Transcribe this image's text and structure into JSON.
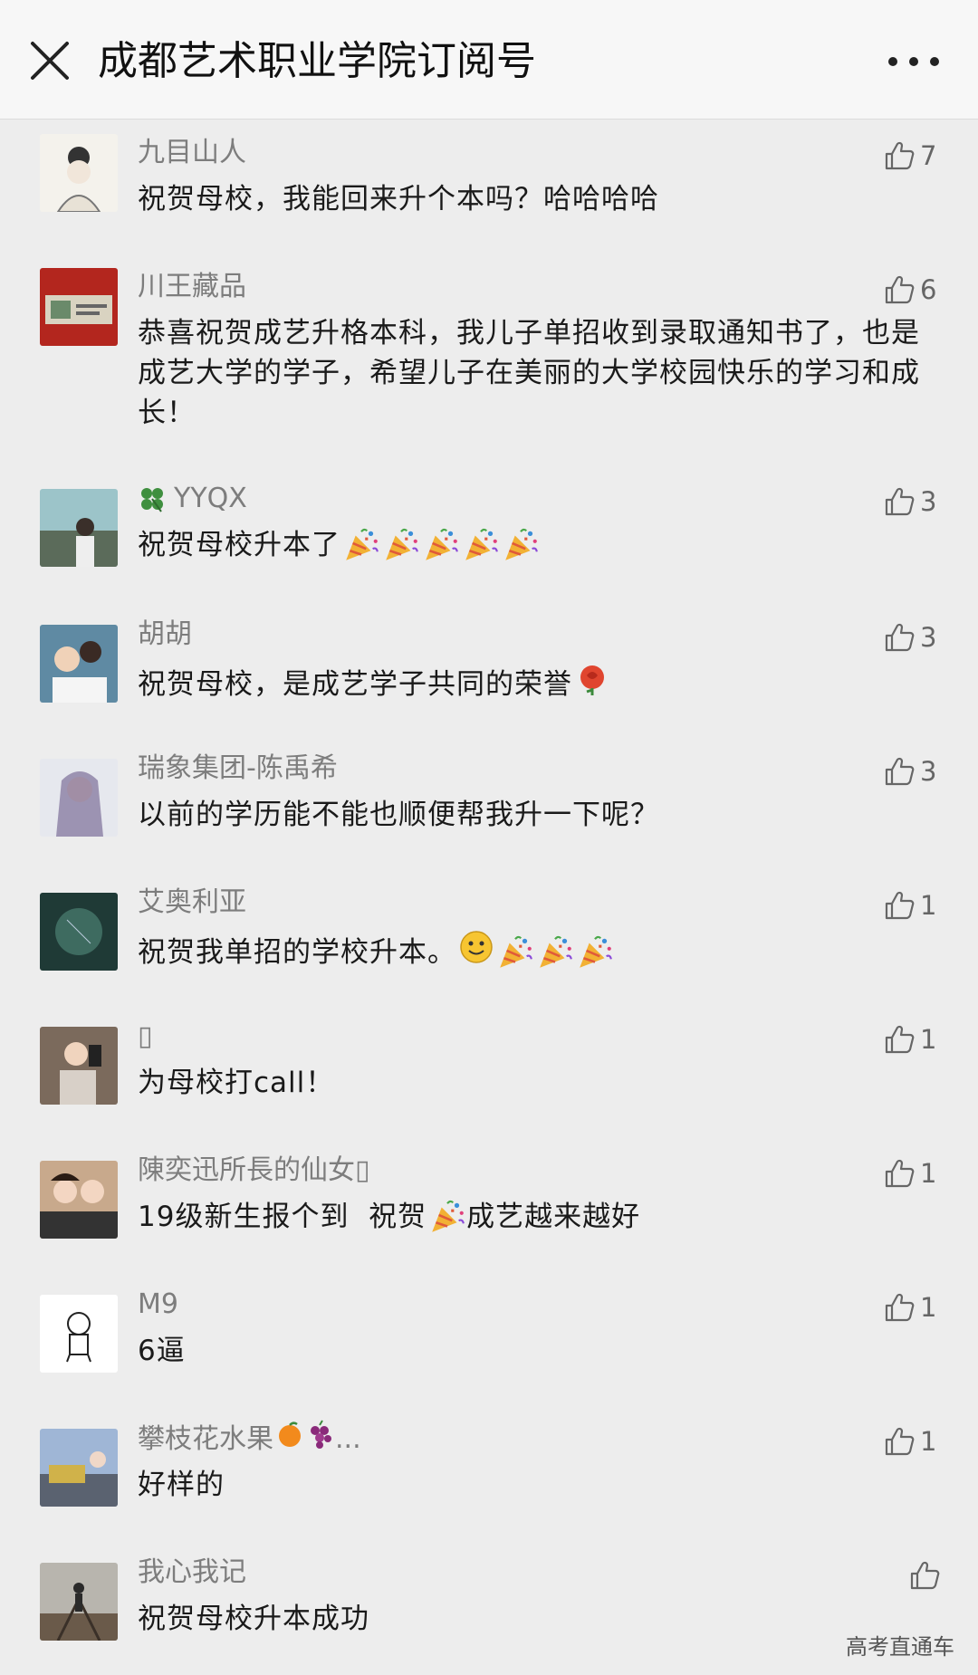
{
  "header": {
    "title": "成都艺术职业学院订阅号"
  },
  "comments": [
    {
      "nick": "九目山人",
      "content": "祝贺母校，我能回来升个本吗？哈哈哈哈",
      "likes": "7"
    },
    {
      "nick": "川王藏品",
      "content": "恭喜祝贺成艺升格本科，我儿子单招收到录取通知书了，也是成艺大学的学子，希望儿子在美丽的大学校园快乐的学习和成长！",
      "likes": "6"
    },
    {
      "nick": "YYQX",
      "content": "祝贺母校升本了",
      "likes": "3"
    },
    {
      "nick": "胡胡",
      "content": "祝贺母校，是成艺学子共同的荣誉",
      "likes": "3"
    },
    {
      "nick": "瑞象集团-陈禹希",
      "content": "以前的学历能不能也顺便帮我升一下呢？",
      "likes": "3"
    },
    {
      "nick": "艾奥利亚",
      "content": "祝贺我单招的学校升本。",
      "likes": "1"
    },
    {
      "nick": "▯",
      "content": "为母校打call！",
      "likes": "1"
    },
    {
      "nick": "陳奕迅所長的仙女▯",
      "content_pre": "19级新生报个到  祝贺",
      "content_post": "成艺越来越好",
      "likes": "1"
    },
    {
      "nick": "M9",
      "content": "6逼",
      "likes": "1"
    },
    {
      "nick_pre": "攀枝花水果",
      "nick_post": "...",
      "content": "好样的",
      "likes": "1"
    },
    {
      "nick": "我心我记",
      "content": "祝贺母校升本成功",
      "likes": ""
    }
  ],
  "watermark": "高考直通车",
  "colors": {
    "background": "#ededed",
    "nick": "#7d7d7d",
    "text": "#1a1a1a"
  }
}
